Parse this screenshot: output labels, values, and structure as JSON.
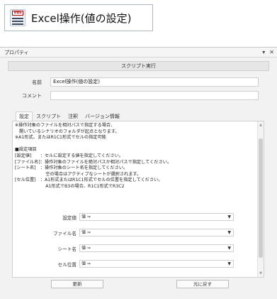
{
  "header": {
    "icon_label": "VBS",
    "title": "Excel操作(値の設定)"
  },
  "window": {
    "title": "プロパティ",
    "pin_glyph": "▾",
    "close_glyph": "✕",
    "section_title": "スクリプト実行"
  },
  "form": {
    "name_label": "名前",
    "name_value": "Excel操作(値の設定)",
    "comment_label": "コメント",
    "comment_value": ""
  },
  "tabs": [
    "設定",
    "スクリプト",
    "注釈",
    "バージョン情報"
  ],
  "active_tab": 0,
  "description": [
    "※操作対象のファイルを相対パスで指定する場合、",
    "　開いているシナリオのフォルダが起点となります。",
    "※A1形式、またはR1C1形式でセルの指定可能",
    "",
    "■設定項目",
    "[設定値]　　：セルに設定する値を指定してください。",
    "[ファイル名]：操作対象のファイルを絶対パスか相対パスで指定してください。",
    "[シート名]　：操作対象のシート名を指定してください。",
    "　　　　　　　空の場合はアクティブなシートが選択されます。",
    "[セル位置]　：A1形式またはR1C1形式でセルの位置を指定してください。",
    "　　　　　　　A1形式でB3の場合、R1C1形式でR3C2"
  ],
  "params": [
    {
      "label": "設定値",
      "value": "値 ⇒"
    },
    {
      "label": "ファイル名",
      "value": "値 ⇒"
    },
    {
      "label": "シート名",
      "value": "値 ⇒"
    },
    {
      "label": "セル位置",
      "value": "値 ⇒"
    }
  ],
  "buttons": {
    "update": "更新",
    "revert": "元に戻す"
  },
  "dropdown_glyph": "▼",
  "scroll_up_glyph": "▲",
  "scroll_down_glyph": "▼"
}
